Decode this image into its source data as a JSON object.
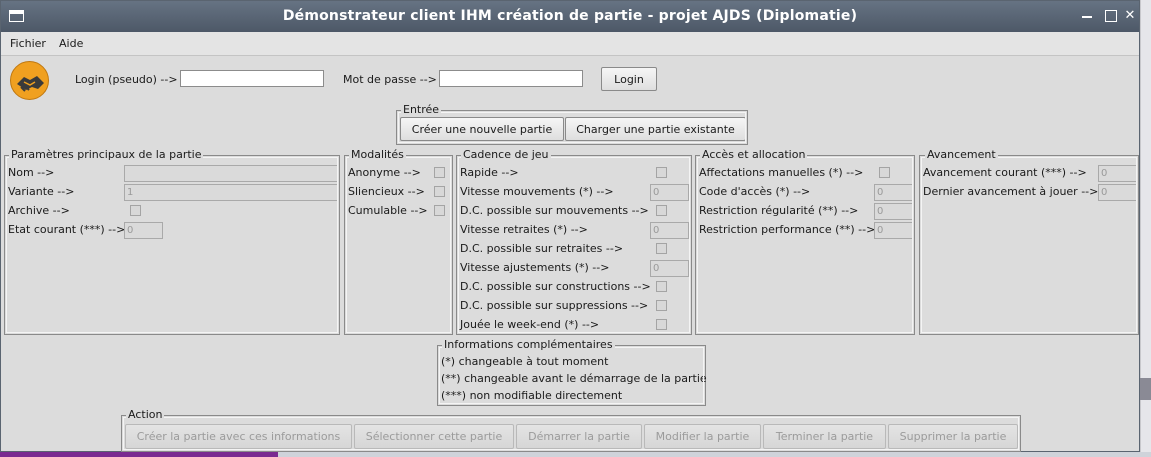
{
  "window": {
    "title": "Démonstrateur client IHM création de partie - projet AJDS (Diplomatie)"
  },
  "menu": [
    "Fichier",
    "Aide"
  ],
  "login": {
    "pseudo_label": "Login (pseudo) -->",
    "password_label": "Mot de passe -->",
    "login_button": "Login"
  },
  "entree": {
    "legend": "Entrée",
    "create_button": "Créer une nouvelle partie",
    "load_button": "Charger une partie existante"
  },
  "params": {
    "legend": "Paramètres principaux de la partie",
    "nom": "Nom -->",
    "variante": "Variante -->",
    "variante_value": "1",
    "archive": "Archive -->",
    "etat": "Etat courant (***) -->",
    "etat_value": "0"
  },
  "modalites": {
    "legend": "Modalités",
    "anonyme": "Anonyme -->",
    "silencieux": "Sliencieux -->",
    "cumulable": "Cumulable -->"
  },
  "cadence": {
    "legend": "Cadence de jeu",
    "rapide": "Rapide -->",
    "vitesse_mouvements": "Vitesse mouvements (*) -->",
    "vitesse_mouvements_value": "0",
    "dc_mouvements": "D.C. possible sur mouvements -->",
    "vitesse_retraites": "Vitesse retraites (*) -->",
    "vitesse_retraites_value": "0",
    "dc_retraites": "D.C. possible sur retraites -->",
    "vitesse_ajustements": "Vitesse ajustements (*) -->",
    "vitesse_ajustements_value": "0",
    "dc_constructions": "D.C. possible sur constructions -->",
    "dc_suppressions": "D.C. possible sur suppressions -->",
    "weekend": "Jouée le week-end (*) -->"
  },
  "acces": {
    "legend": "Accès et allocation",
    "affectations": "Affectations manuelles (*) -->",
    "code": "Code d'accès (*) -->",
    "code_value": "0",
    "regularite": "Restriction régularité (**) -->",
    "regularite_value": "0",
    "performance": "Restriction performance (**) -->",
    "performance_value": "0"
  },
  "avancement": {
    "legend": "Avancement",
    "courant": "Avancement courant (***) -->",
    "courant_value": "0",
    "dernier": "Dernier avancement à jouer -->",
    "dernier_value": "0"
  },
  "infos": {
    "legend": "Informations complémentaires",
    "line1": "(*) changeable à tout moment",
    "line2": "(**) changeable avant le démarrage de la partie",
    "line3": "(***) non modifiable directement"
  },
  "action": {
    "legend": "Action",
    "creer": "Créer la partie avec ces informations",
    "selectionner": "Sélectionner cette partie",
    "demarrer": "Démarrer la partie",
    "modifier": "Modifier la partie",
    "terminer": "Terminer la partie",
    "supprimer": "Supprimer la partie"
  }
}
